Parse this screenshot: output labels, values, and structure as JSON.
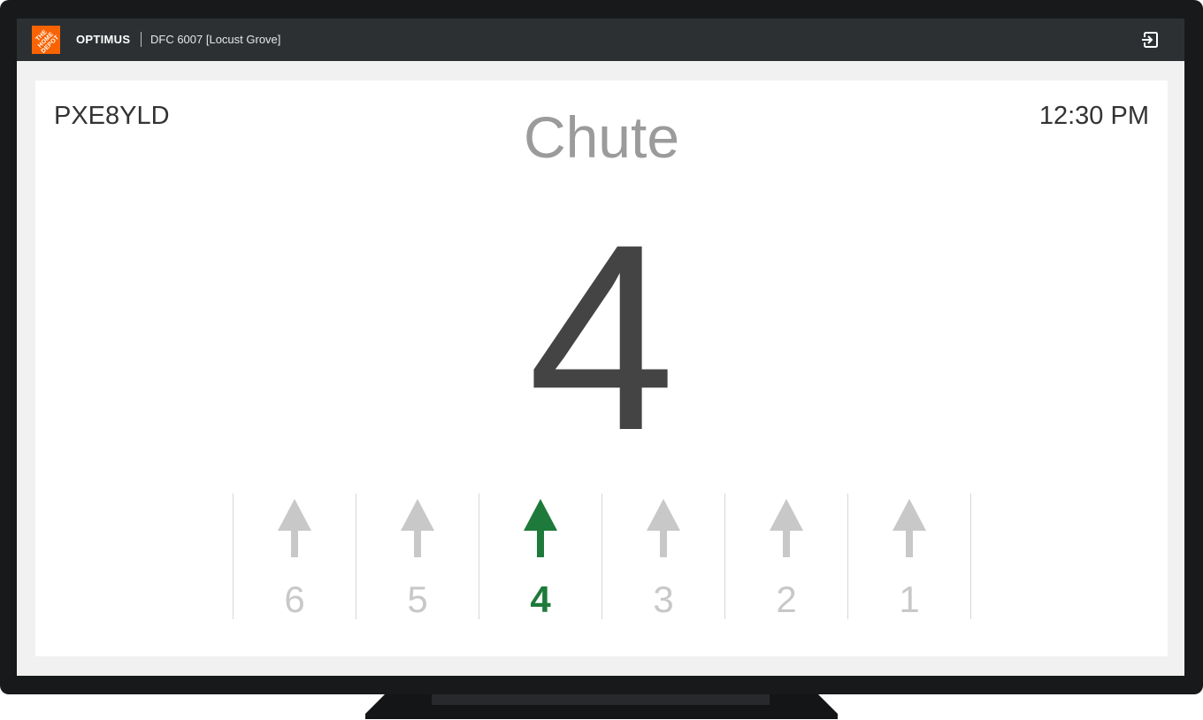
{
  "header": {
    "logo_text": "THE HOME DEPOT",
    "app_name": "OPTIMUS",
    "location": "DFC 6007 [Locust Grove]",
    "logout_icon": "logout-icon"
  },
  "main": {
    "device_id": "PXE8YLD",
    "time": "12:30 PM",
    "chute_label": "Chute",
    "chute_number": "4"
  },
  "lanes": [
    {
      "label": "6",
      "active": false
    },
    {
      "label": "5",
      "active": false
    },
    {
      "label": "4",
      "active": true
    },
    {
      "label": "3",
      "active": false
    },
    {
      "label": "2",
      "active": false
    },
    {
      "label": "1",
      "active": false
    }
  ],
  "colors": {
    "active": "#1e7a3a",
    "inactive": "#c8c8c8",
    "brand": "#f96302",
    "topbar": "#2d3033"
  }
}
